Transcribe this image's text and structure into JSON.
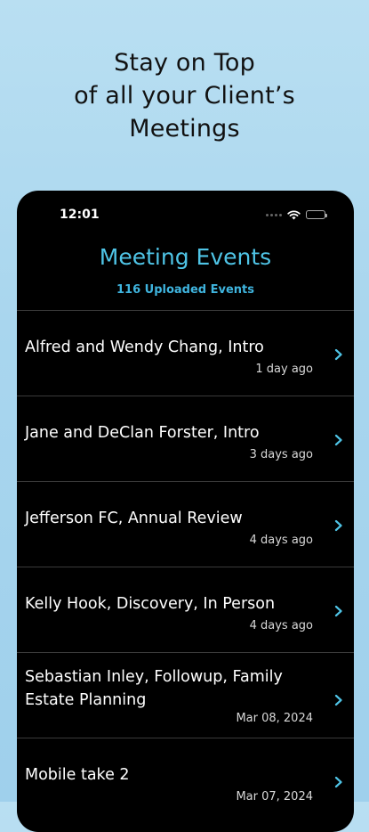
{
  "promo": {
    "line1": "Stay on Top",
    "line2": "of all your Client’s",
    "line3": "Meetings"
  },
  "status_bar": {
    "time": "12:01"
  },
  "screen": {
    "title": "Meeting Events",
    "subtitle": "116 Uploaded Events"
  },
  "events": [
    {
      "title": "Alfred and Wendy Chang, Intro",
      "time": "1 day ago"
    },
    {
      "title": "Jane and DeClan Forster, Intro",
      "time": "3 days ago"
    },
    {
      "title": "Jefferson FC, Annual Review",
      "time": "4 days ago"
    },
    {
      "title": "Kelly Hook, Discovery, In Person",
      "time": "4 days ago"
    },
    {
      "title": "Sebastian Inley, Followup, Family Estate Planning",
      "time": "Mar 08, 2024"
    },
    {
      "title": "Mobile take 2",
      "time": "Mar 07, 2024"
    }
  ],
  "colors": {
    "accent": "#4fc4e6",
    "background_gradient_top": "#b9dff2",
    "phone_background": "#000000",
    "text_primary": "#ffffff"
  },
  "icons": {
    "row_chevron": "chevron-right-icon",
    "wifi": "wifi-icon",
    "battery": "battery-icon"
  }
}
